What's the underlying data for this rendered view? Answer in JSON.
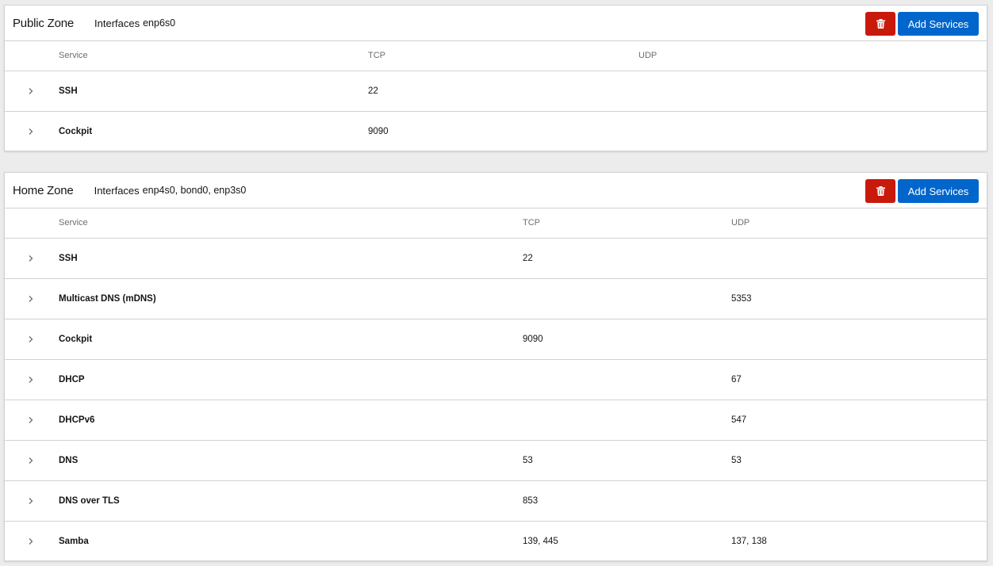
{
  "zones": [
    {
      "title": "Public Zone",
      "interfaces_label": "Interfaces",
      "interfaces": "enp6s0",
      "add_services_label": "Add Services",
      "columns": {
        "service": "Service",
        "tcp": "TCP",
        "udp": "UDP"
      },
      "services": [
        {
          "name": "SSH",
          "tcp": "22",
          "udp": ""
        },
        {
          "name": "Cockpit",
          "tcp": "9090",
          "udp": ""
        }
      ]
    },
    {
      "title": "Home Zone",
      "interfaces_label": "Interfaces",
      "interfaces": "enp4s0, bond0, enp3s0",
      "add_services_label": "Add Services",
      "columns": {
        "service": "Service",
        "tcp": "TCP",
        "udp": "UDP"
      },
      "services": [
        {
          "name": "SSH",
          "tcp": "22",
          "udp": ""
        },
        {
          "name": "Multicast DNS (mDNS)",
          "tcp": "",
          "udp": "5353"
        },
        {
          "name": "Cockpit",
          "tcp": "9090",
          "udp": ""
        },
        {
          "name": "DHCP",
          "tcp": "",
          "udp": "67"
        },
        {
          "name": "DHCPv6",
          "tcp": "",
          "udp": "547"
        },
        {
          "name": "DNS",
          "tcp": "53",
          "udp": "53"
        },
        {
          "name": "DNS over TLS",
          "tcp": "853",
          "udp": ""
        },
        {
          "name": "Samba",
          "tcp": "139, 445",
          "udp": "137, 138"
        }
      ]
    }
  ],
  "icons": {
    "delete": "trash-icon",
    "expand": "chevron-right-icon"
  },
  "colors": {
    "danger": "#c9190b",
    "primary": "#0066cc",
    "background": "#ececec",
    "border": "#d2d2d2"
  }
}
